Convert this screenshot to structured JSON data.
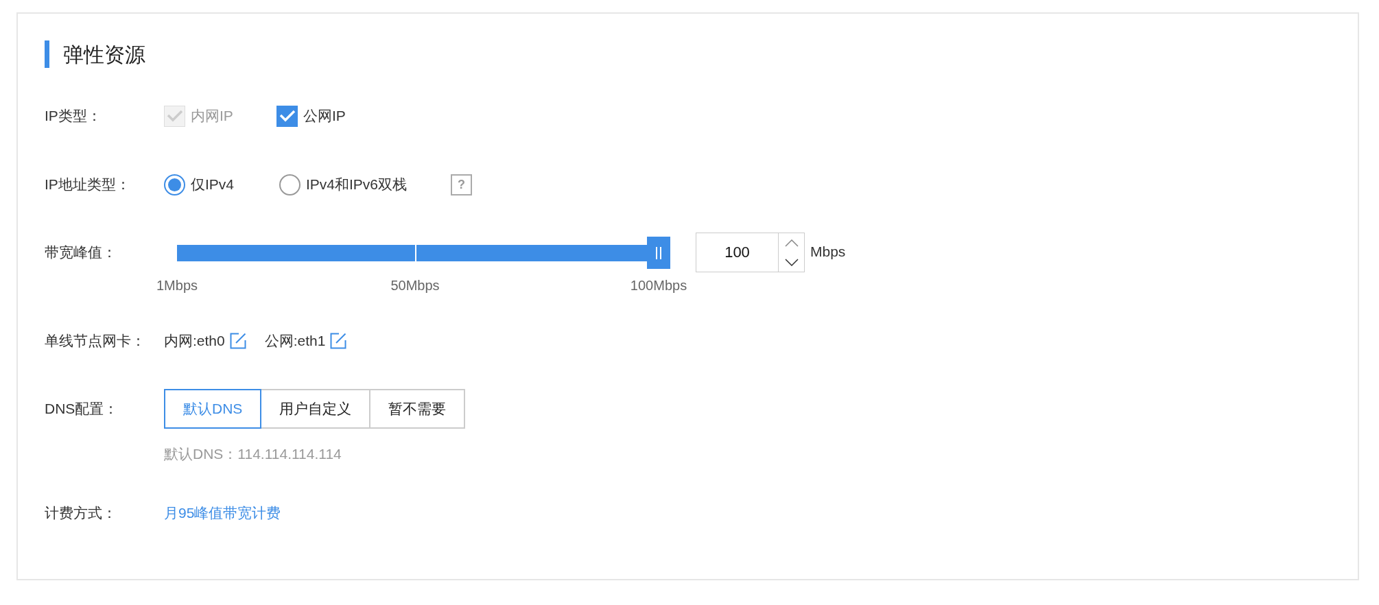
{
  "section_title": "弹性资源",
  "ip_type": {
    "label": "IP类型：",
    "options": [
      {
        "label": "内网IP",
        "checked": true,
        "disabled": true
      },
      {
        "label": "公网IP",
        "checked": true,
        "disabled": false
      }
    ]
  },
  "ip_address_type": {
    "label": "IP地址类型：",
    "options": [
      {
        "label": "仅IPv4",
        "selected": true
      },
      {
        "label": "IPv4和IPv6双栈",
        "selected": false
      }
    ],
    "help": "?"
  },
  "bandwidth": {
    "label": "带宽峰值：",
    "level": 1,
    "ticks": [
      "1Mbps",
      "50Mbps",
      "100Mbps"
    ],
    "value": "100",
    "unit": "Mbps"
  },
  "nic": {
    "label": "单线节点网卡：",
    "items": [
      "内网:eth0",
      "公网:eth1"
    ]
  },
  "dns": {
    "label": "DNS配置：",
    "options": [
      {
        "label": "默认DNS",
        "selected": true
      },
      {
        "label": "用户自定义",
        "selected": false
      },
      {
        "label": "暂不需要",
        "selected": false
      }
    ],
    "hint": "默认DNS：114.114.114.114"
  },
  "billing": {
    "label": "计费方式：",
    "value": "月95峰值带宽计费"
  }
}
